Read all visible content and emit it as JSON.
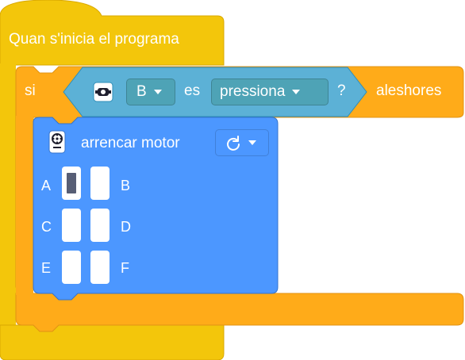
{
  "hat_block": {
    "label": "Quan s'inicia el programa"
  },
  "if_block": {
    "if_label": "si",
    "then_label": "aleshores",
    "condition": {
      "sensor_icon": "force-sensor-icon",
      "port_value": "B",
      "es_label": "es",
      "state_value": "pressiona",
      "question_mark": "?"
    }
  },
  "motor_block": {
    "label": "arrencar motor",
    "icon": "motor-hub-icon",
    "direction_icon": "clockwise-arrow-icon",
    "ports": [
      {
        "label": "A",
        "selected": true
      },
      {
        "label": "B",
        "selected": false
      },
      {
        "label": "C",
        "selected": false
      },
      {
        "label": "D",
        "selected": false
      },
      {
        "label": "E",
        "selected": false
      },
      {
        "label": "F",
        "selected": false
      }
    ]
  },
  "colors": {
    "events": "#f3c60b",
    "events_border": "#d9a800",
    "control": "#ffab19",
    "control_border": "#e09314",
    "motion": "#4c97ff",
    "motion_border": "#3373cc",
    "sensing": "#5cb1d6",
    "sensing_border": "#2e8eb8"
  }
}
